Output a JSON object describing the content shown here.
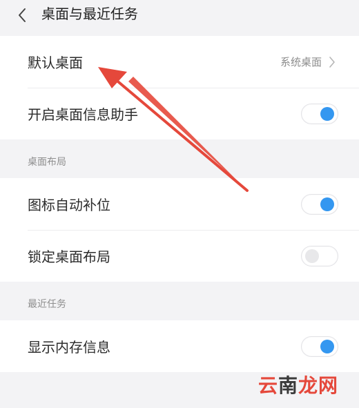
{
  "header": {
    "title": "桌面与最近任务",
    "back_icon": "chevron-left-icon"
  },
  "group1": {
    "default_desktop": {
      "label": "默认桌面",
      "value": "系统桌面"
    },
    "desktop_assistant": {
      "label": "开启桌面信息助手",
      "enabled": true
    }
  },
  "layout_section": {
    "title": "桌面布局",
    "auto_fill_icons": {
      "label": "图标自动补位",
      "enabled": true
    },
    "lock_layout": {
      "label": "锁定桌面布局",
      "enabled": false
    }
  },
  "recent_section": {
    "title": "最近任务",
    "show_memory": {
      "label": "显示内存信息",
      "enabled": true
    }
  },
  "colors": {
    "toggle_on": "#3497f0",
    "annotation_arrow": "#e5483b"
  },
  "watermark": {
    "part1": "云",
    "part2": "南",
    "part3": "龙网"
  }
}
